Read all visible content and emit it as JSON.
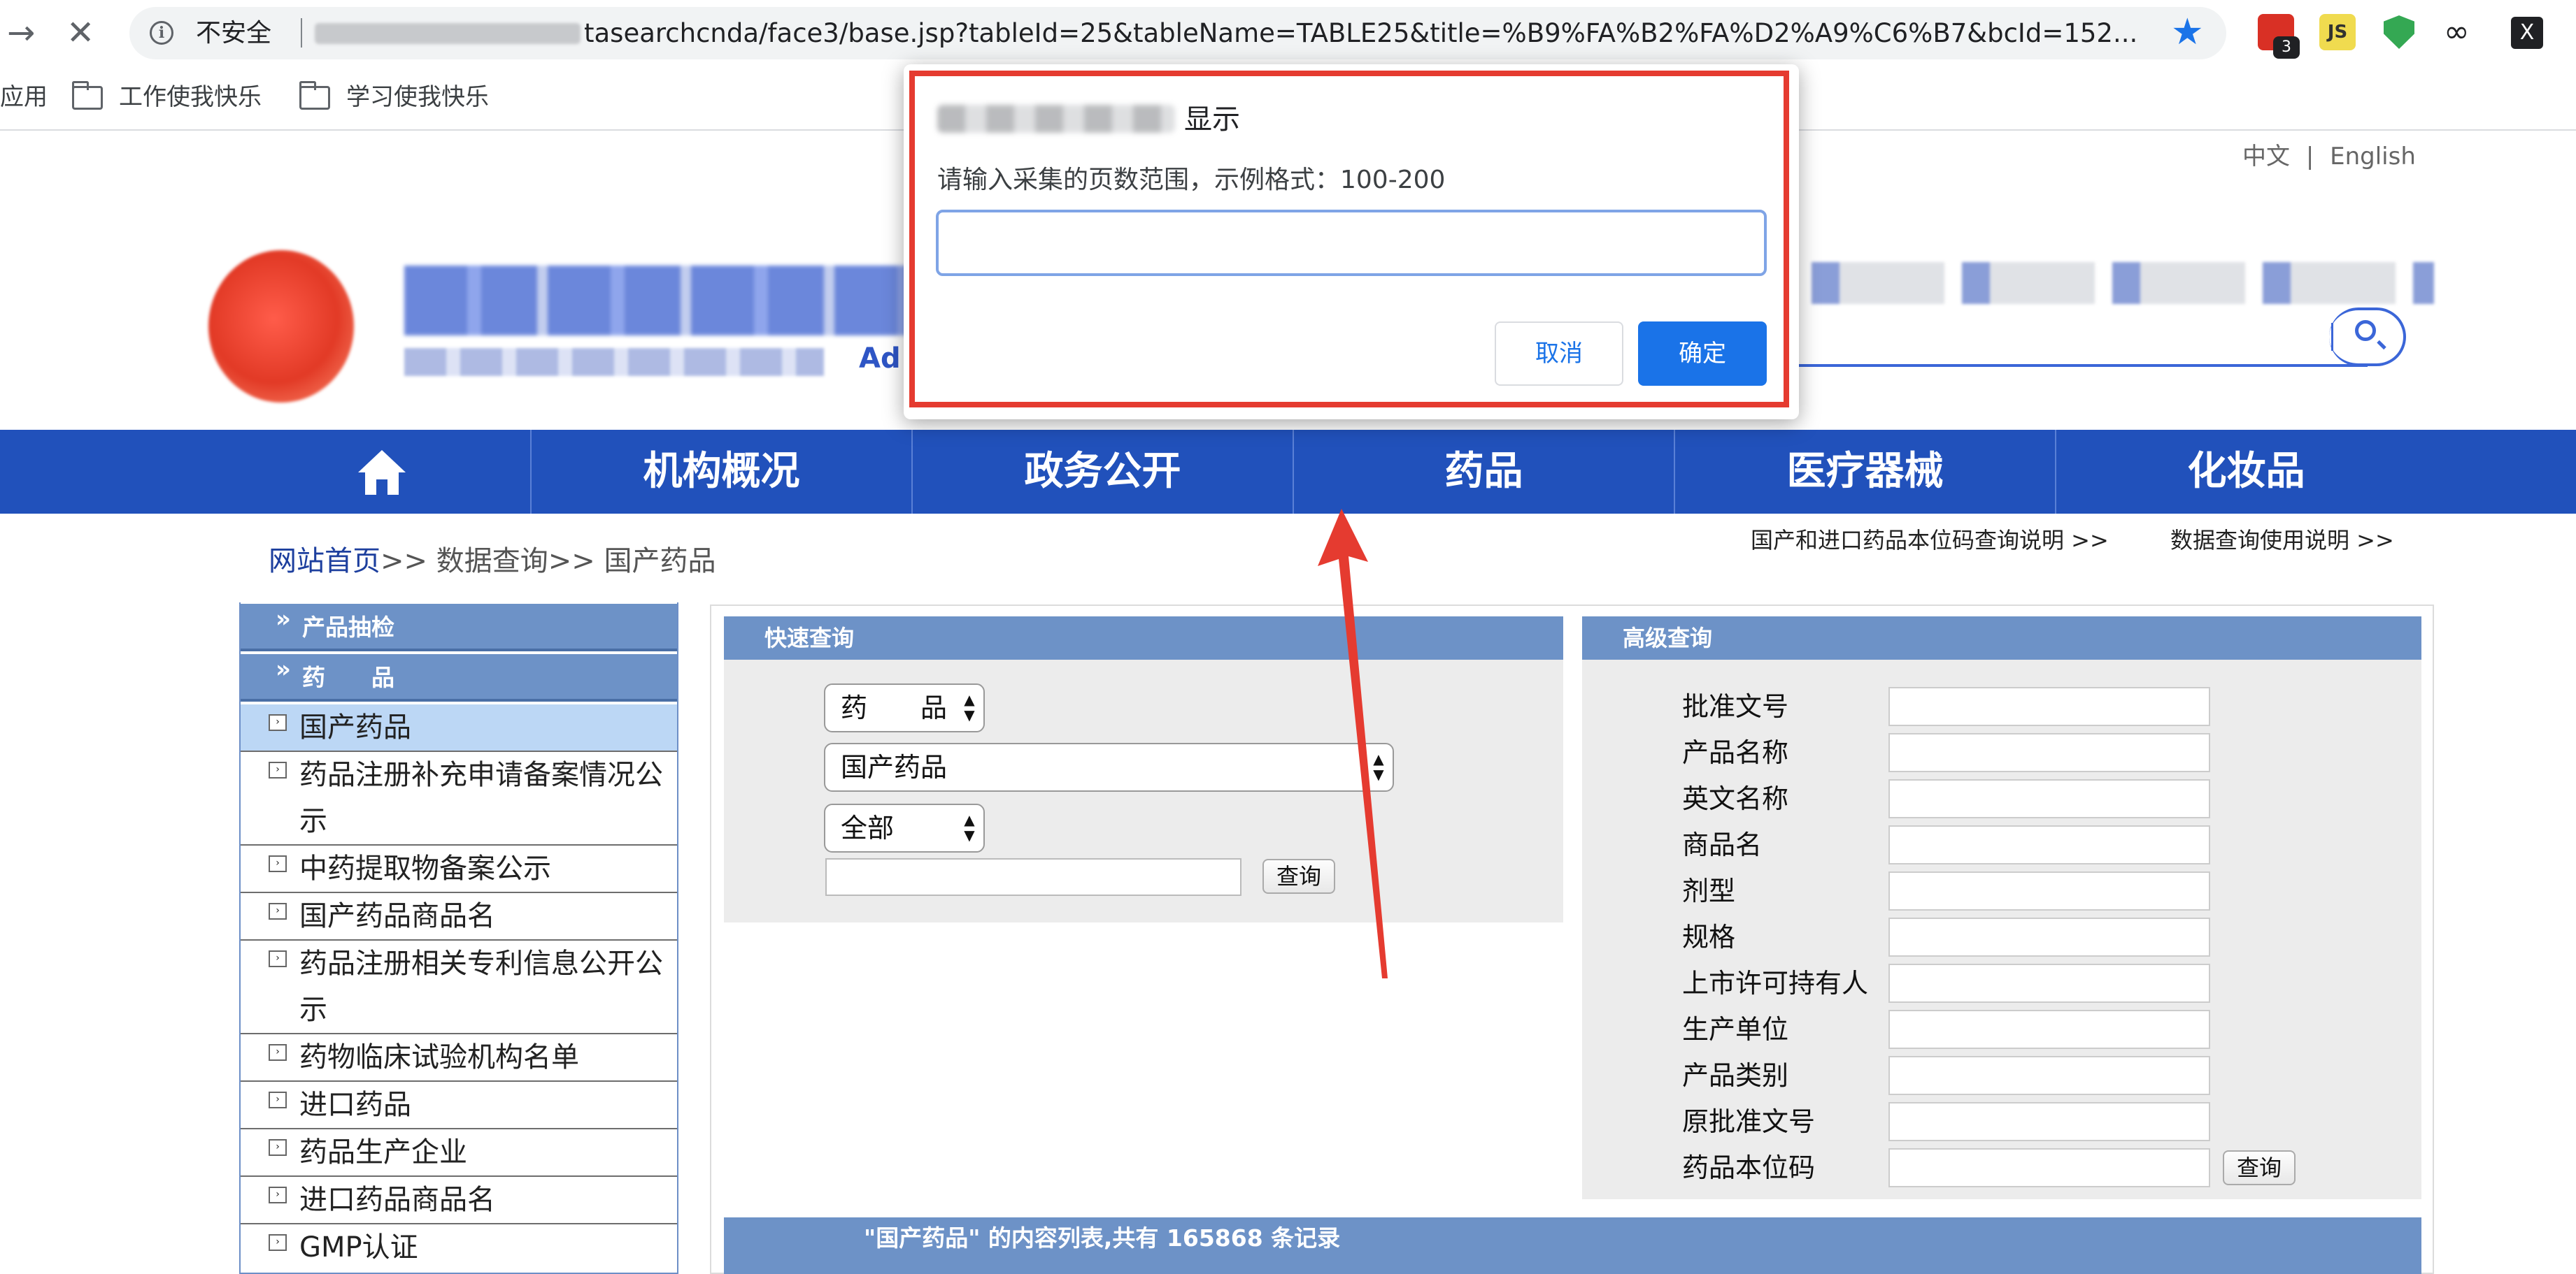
{
  "browser": {
    "back_glyph": "→",
    "close_glyph": "✕",
    "security_label": "不安全",
    "url_visible": "tasearchcnda/face3/base.jsp?tableId=25&tableName=TABLE25&title=%B9%FA%B2%FA%D2%A9%C6%B7&bcId=152...",
    "star_glyph": "★",
    "ext_badge": "3",
    "ext_js_label": "JS",
    "ext_link_glyph": "∞",
    "ext_x_label": "X",
    "bookmarks": [
      "应用",
      "工作使我快乐",
      "学习使我快乐"
    ]
  },
  "header": {
    "lang_zh": "中文",
    "lang_sep": "|",
    "lang_en": "English",
    "logo_tail": "Ad"
  },
  "nav": {
    "items": [
      "机构概况",
      "政务公开",
      "药品",
      "医疗器械",
      "化妆品"
    ]
  },
  "breadcrumb": {
    "home": "网站首页",
    "rest": ">> 数据查询>> 国产药品"
  },
  "help_links": [
    "国产和进口药品本位码查询说明 >>",
    "数据查询使用说明 >>"
  ],
  "sidebar": {
    "categories": [
      "产品抽检",
      "药　　品"
    ],
    "items": [
      "国产药品",
      "药品注册补充申请备案情况公示",
      "中药提取物备案公示",
      "国产药品商品名",
      "药品注册相关专利信息公开公示",
      "药物临床试验机构名单",
      "进口药品",
      "药品生产企业",
      "进口药品商品名",
      "GMP认证"
    ]
  },
  "quick": {
    "title": "快速查询",
    "category": "药　　品",
    "table": "国产药品",
    "scope": "全部",
    "query_button": "查询"
  },
  "advanced": {
    "title": "高级查询",
    "labels": [
      "批准文号",
      "产品名称",
      "英文名称",
      "商品名",
      "剂型",
      "规格",
      "上市许可持有人",
      "生产单位",
      "产品类别",
      "原批准文号",
      "药品本位码"
    ],
    "query_button": "查询"
  },
  "list": {
    "header": "\"国产药品\" 的内容列表,共有 165868 条记录"
  },
  "dialog": {
    "title_suffix": "显示",
    "message": "请输入采集的页数范围，示例格式：100-200",
    "input_value": "",
    "cancel": "取消",
    "ok": "确定"
  }
}
